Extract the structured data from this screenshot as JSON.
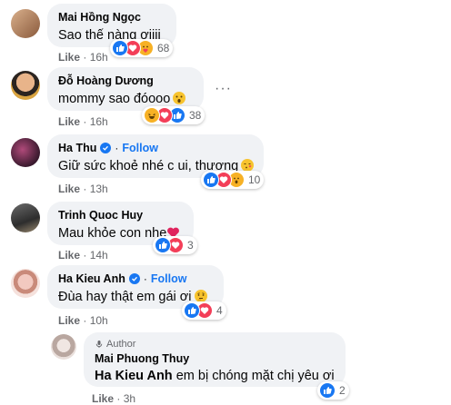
{
  "comments": [
    {
      "name": "Mai Hồng Ngọc",
      "text": "Sao thế nàng ơiiii",
      "like": "Like",
      "time": "16h",
      "reactions": [
        "like",
        "love",
        "care"
      ],
      "count": "68"
    },
    {
      "name": "Đỗ Hoàng Dương",
      "text": "mommy sao đóooo",
      "like": "Like",
      "time": "16h",
      "reactions": [
        "haha",
        "love",
        "like"
      ],
      "count": "38",
      "text_emoji": "wow-emoji"
    },
    {
      "name": "Ha Thu",
      "follow": "Follow",
      "text": "Giữ sức khoẻ nhé c ui, thương",
      "like": "Like",
      "time": "13h",
      "reactions": [
        "like",
        "love",
        "wow"
      ],
      "count": "10",
      "text_emoji": "kiss-emoji"
    },
    {
      "name": "Trinh Quoc Huy",
      "text": "Mau khỏe con nhe",
      "like": "Like",
      "time": "14h",
      "reactions": [
        "like",
        "love"
      ],
      "count": "3",
      "text_emoji": "red-heart"
    },
    {
      "name": "Ha Kieu Anh",
      "follow": "Follow",
      "text": "Đùa hay thật em gái ơi",
      "like": "Like",
      "time": "10h",
      "reactions": [
        "like",
        "love"
      ],
      "count": "4",
      "text_emoji": "thinking-emoji"
    }
  ],
  "reply": {
    "author_label": "Author",
    "name": "Mai Phuong Thuy",
    "mention": "Ha Kieu Anh",
    "text": "em bị chóng mặt chị yêu ơi",
    "like": "Like",
    "time": "3h",
    "reactions": [
      "like"
    ],
    "count": "2"
  },
  "separator": "·",
  "more_label": "···",
  "colors": {
    "bubble": "#f0f2f5",
    "link": "#1877f2",
    "meta": "#65676b",
    "love": "#f33e58",
    "haha": "#f7b125"
  }
}
